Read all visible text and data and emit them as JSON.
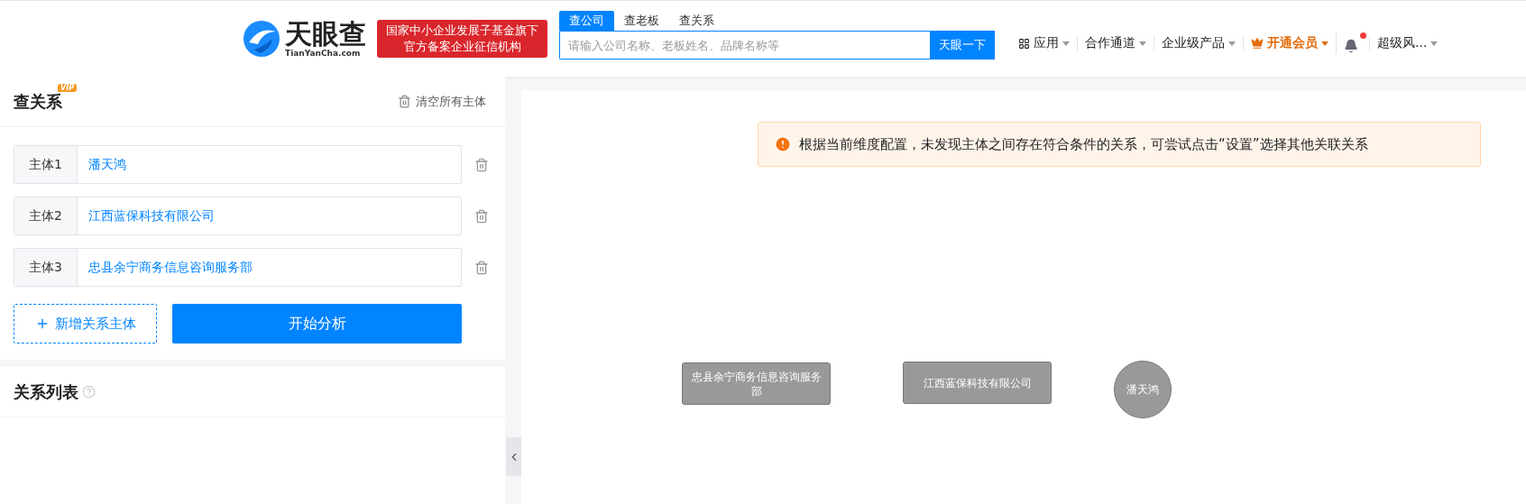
{
  "header": {
    "logo": {
      "name": "天眼查",
      "domain": "TianYanCha.com"
    },
    "badge_lines": [
      "国家中小企业发展子基金旗下",
      "官方备案企业征信机构"
    ],
    "search": {
      "tabs": [
        {
          "label": "查公司",
          "selected": true
        },
        {
          "label": "查老板",
          "selected": false
        },
        {
          "label": "查关系",
          "selected": false
        }
      ],
      "placeholder": "请输入公司名称、老板姓名、品牌名称等",
      "button": "天眼一下"
    },
    "nav": [
      {
        "kind": "apps",
        "label": "应用"
      },
      {
        "kind": "plain",
        "label": "合作通道"
      },
      {
        "kind": "plain",
        "label": "企业级产品"
      },
      {
        "kind": "vip",
        "label": "开通会员"
      },
      {
        "kind": "bell",
        "unread": true
      },
      {
        "kind": "user",
        "label": "超级风..."
      }
    ]
  },
  "panel": {
    "title": "查关系",
    "vip_badge": "VIP",
    "clear_button": "清空所有主体",
    "subjects": [
      {
        "label": "主体1",
        "value": "潘天鸿"
      },
      {
        "label": "主体2",
        "value": "江西蓝保科技有限公司"
      },
      {
        "label": "主体3",
        "value": "忠县余宁商务信息咨询服务部"
      }
    ],
    "add_button": "新增关系主体",
    "analyze_button": "开始分析",
    "list_title": "关系列表"
  },
  "canvas": {
    "notice": "根据当前维度配置，未发现主体之间存在符合条件的关系，可尝试点击“设置”选择其他关联关系",
    "nodes": [
      {
        "kind": "company",
        "label": "忠县余宁商务信息咨询服务部"
      },
      {
        "kind": "company",
        "label": "江西蓝保科技有限公司"
      },
      {
        "kind": "person",
        "label": "潘天鸿"
      }
    ]
  }
}
